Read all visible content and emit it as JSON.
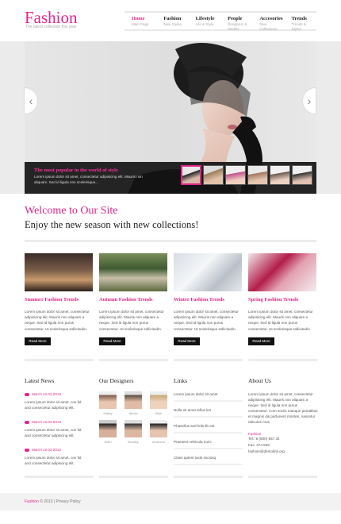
{
  "header": {
    "logo": "Fashion",
    "tagline": "The latest collection this year"
  },
  "nav": [
    {
      "label": "Home",
      "sub": "Main Page"
    },
    {
      "label": "Fashion",
      "sub": "New Styles"
    },
    {
      "label": "Lifestyle",
      "sub": "Life & Style"
    },
    {
      "label": "People",
      "sub": "Designers & Models"
    },
    {
      "label": "Accesories",
      "sub": "New Collections"
    },
    {
      "label": "Trends",
      "sub": "Trends & Styles"
    }
  ],
  "slider": {
    "caption_title": "The most popular in the world of style",
    "caption_text": "Lorem ipsum dolor sit amet, consectetur adipisicing elit. Mauris non aliquam. Sed id ligula non scelerisque..."
  },
  "welcome": {
    "title": "Welcome to Our Site",
    "subtitle": "Enjoy the new season with new collections!"
  },
  "features": [
    {
      "title": "Summer Fashion Trends",
      "text": "Lorem ipsum dolor sit amet, consectetur adipisicing elit. Mauris non aliquam a neque. Sed id ligula non purus consectetur. Ut scelerisque sollicitudin.",
      "button": "Read More"
    },
    {
      "title": "Autumn Fashion Trends",
      "text": "Lorem ipsum dolor sit amet, consectetur adipisicing elit. Mauris non aliquam a neque. Sed id ligula non purus consectetur. Ut scelerisque sollicitudin.",
      "button": "Read More"
    },
    {
      "title": "Winter  Fashion Trends",
      "text": "Lorem ipsum dolor sit amet, consectetur adipisicing elit. Mauris non aliquam a neque. Sed id ligula non purus consectetur. Ut scelerisque sollicitudin.",
      "button": "Read More"
    },
    {
      "title": "Spring Fashion Trends",
      "text": "Lorem ipsum dolor sit amet, consectetur adipisicing elit. Mauris non aliquam a neque. Sed id ligula non purus consectetur. Ut scelerisque sollicitudin.",
      "button": "Read More"
    }
  ],
  "latest_news": {
    "title": "Latest News",
    "items": [
      {
        "date": "March 12.03.2012",
        "text": "Lorem ipsum dolor sit amet, con fid and consectetur adipiscing elit."
      },
      {
        "date": "March 12.03.2012",
        "text": "Lorem ipsum dolor sit amet, con fid and consectetur adipiscing elit."
      },
      {
        "date": "March 12.03.2012",
        "text": "Lorem ipsum dolor sit amet, con fid and consectetur adipiscing elit."
      }
    ]
  },
  "designers": {
    "title": "Our Designers",
    "items": [
      {
        "name": "Hailey"
      },
      {
        "name": "Nicole"
      },
      {
        "name": "Blair"
      },
      {
        "name": "Arlith"
      },
      {
        "name": "Bradley"
      },
      {
        "name": "Andromo"
      }
    ]
  },
  "links": {
    "title": "Links",
    "items": [
      "Lorem ipsum dolor sit amet",
      "Nulla sit amet tellus leo",
      "Phasellus sed felis lib est",
      "Praesent vehicula nunc",
      "Class aptent taciti sociosq"
    ]
  },
  "about": {
    "title": "About Us",
    "text": "Lorem ipsum dolor sit amet, consectetur adipisicing elit. Mauris non aliquam a neque. Sed id ligula non purus consectetur. Cum sociis natoque penatibus et magnis dis parturient montes, nascetur ridiculus mus.",
    "brand": "Fashion",
    "tel": "Tel.: 8 (800) 567 34",
    "fax": "Fax: 374 829",
    "email": "fashion@demolink.org"
  },
  "footer": {
    "brand": "Fashion",
    "copyright": "© 2013  |  Privacy Policy"
  },
  "colors": {
    "accent": "#e0268a",
    "dark": "#111111"
  }
}
